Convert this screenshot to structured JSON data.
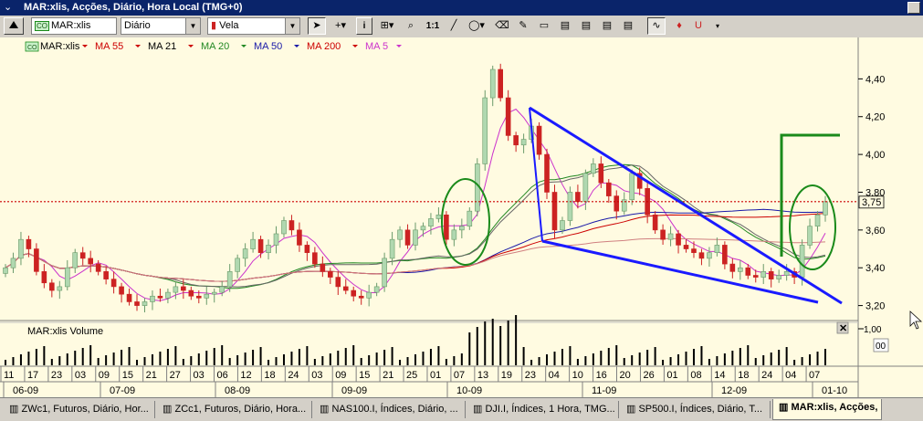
{
  "window": {
    "title": "MAR:xlis, Acções, Diário, Hora Local (TMG+0)"
  },
  "toolbar": {
    "symbol_value": "MAR:xlis",
    "symbol_tag": "CO",
    "period_value": "Diário",
    "chart_type_value": "Vela",
    "ratio_label": "1:1"
  },
  "legend": {
    "items": [
      {
        "label": "MAR:xlis",
        "color": "#000000"
      },
      {
        "label": "MA 55",
        "color": "#cc0000"
      },
      {
        "label": "MA 21",
        "color": "#000000"
      },
      {
        "label": "MA 20",
        "color": "#228822"
      },
      {
        "label": "MA 50",
        "color": "#1a1aa8"
      },
      {
        "label": "MA 200",
        "color": "#cc0000"
      },
      {
        "label": "MA 5",
        "color": "#cc33cc"
      }
    ]
  },
  "price_axis": {
    "ticks": [
      "4,40",
      "4,20",
      "4,00",
      "3,80",
      "3,60",
      "3,40",
      "3,20"
    ],
    "current_price": "3,75"
  },
  "volume_panel": {
    "title": "MAR:xlis Volume",
    "axis_tick": "1,00",
    "axis_sub": "00"
  },
  "time_axis": {
    "days": [
      "11",
      "17",
      "23",
      "03",
      "09",
      "15",
      "21",
      "27",
      "03",
      "06",
      "12",
      "18",
      "24",
      "03",
      "09",
      "15",
      "21",
      "25",
      "01",
      "07",
      "13",
      "19",
      "23",
      "04",
      "10",
      "16",
      "20",
      "26",
      "01",
      "08",
      "14",
      "18",
      "24",
      "04",
      "07"
    ],
    "months": [
      "06-09",
      "07-09",
      "08-09",
      "09-09",
      "10-09",
      "11-09",
      "12-09",
      "01-10"
    ]
  },
  "tabs": [
    "ZWc1, Futuros, Diário, Hor...",
    "ZCc1, Futuros, Diário, Hora...",
    "NAS100.I, Índices, Diário, ...",
    "DJI.I, Índices, 1 Hora, TMG...",
    "SP500.I, Índices, Diário, T...",
    "MAR:xlis, Acções,"
  ],
  "colors": {
    "background": "#fffbe1",
    "up_candle": "#b0d8b0",
    "down_candle": "#cc2222",
    "trendline": "#1a1aff",
    "annotation": "#1a8a1a",
    "price_line": "#cc0000"
  },
  "chart_data": {
    "type": "candlestick",
    "ylim": [
      3.14,
      4.6
    ],
    "price_close": [
      3.4,
      3.45,
      3.55,
      3.5,
      3.38,
      3.32,
      3.28,
      3.3,
      3.4,
      3.48,
      3.45,
      3.42,
      3.38,
      3.34,
      3.3,
      3.26,
      3.22,
      3.2,
      3.22,
      3.25,
      3.24,
      3.27,
      3.3,
      3.28,
      3.25,
      3.24,
      3.26,
      3.27,
      3.3,
      3.38,
      3.45,
      3.5,
      3.55,
      3.48,
      3.52,
      3.58,
      3.65,
      3.6,
      3.52,
      3.48,
      3.42,
      3.38,
      3.35,
      3.3,
      3.28,
      3.25,
      3.24,
      3.27,
      3.3,
      3.45,
      3.55,
      3.6,
      3.52,
      3.6,
      3.62,
      3.66,
      3.68,
      3.55,
      3.6,
      3.62,
      3.7,
      3.95,
      4.3,
      4.45,
      4.3,
      4.1,
      4.05,
      4.08,
      4.15,
      4.0,
      3.8,
      3.6,
      3.65,
      3.8,
      3.75,
      3.9,
      3.95,
      3.85,
      3.78,
      3.7,
      3.76,
      3.9,
      3.82,
      3.68,
      3.6,
      3.55,
      3.58,
      3.52,
      3.5,
      3.48,
      3.45,
      3.48,
      3.52,
      3.42,
      3.38,
      3.4,
      3.36,
      3.35,
      3.38,
      3.34,
      3.36,
      3.38,
      3.35,
      3.52,
      3.62,
      3.68,
      3.75
    ],
    "price_line": 3.75
  }
}
